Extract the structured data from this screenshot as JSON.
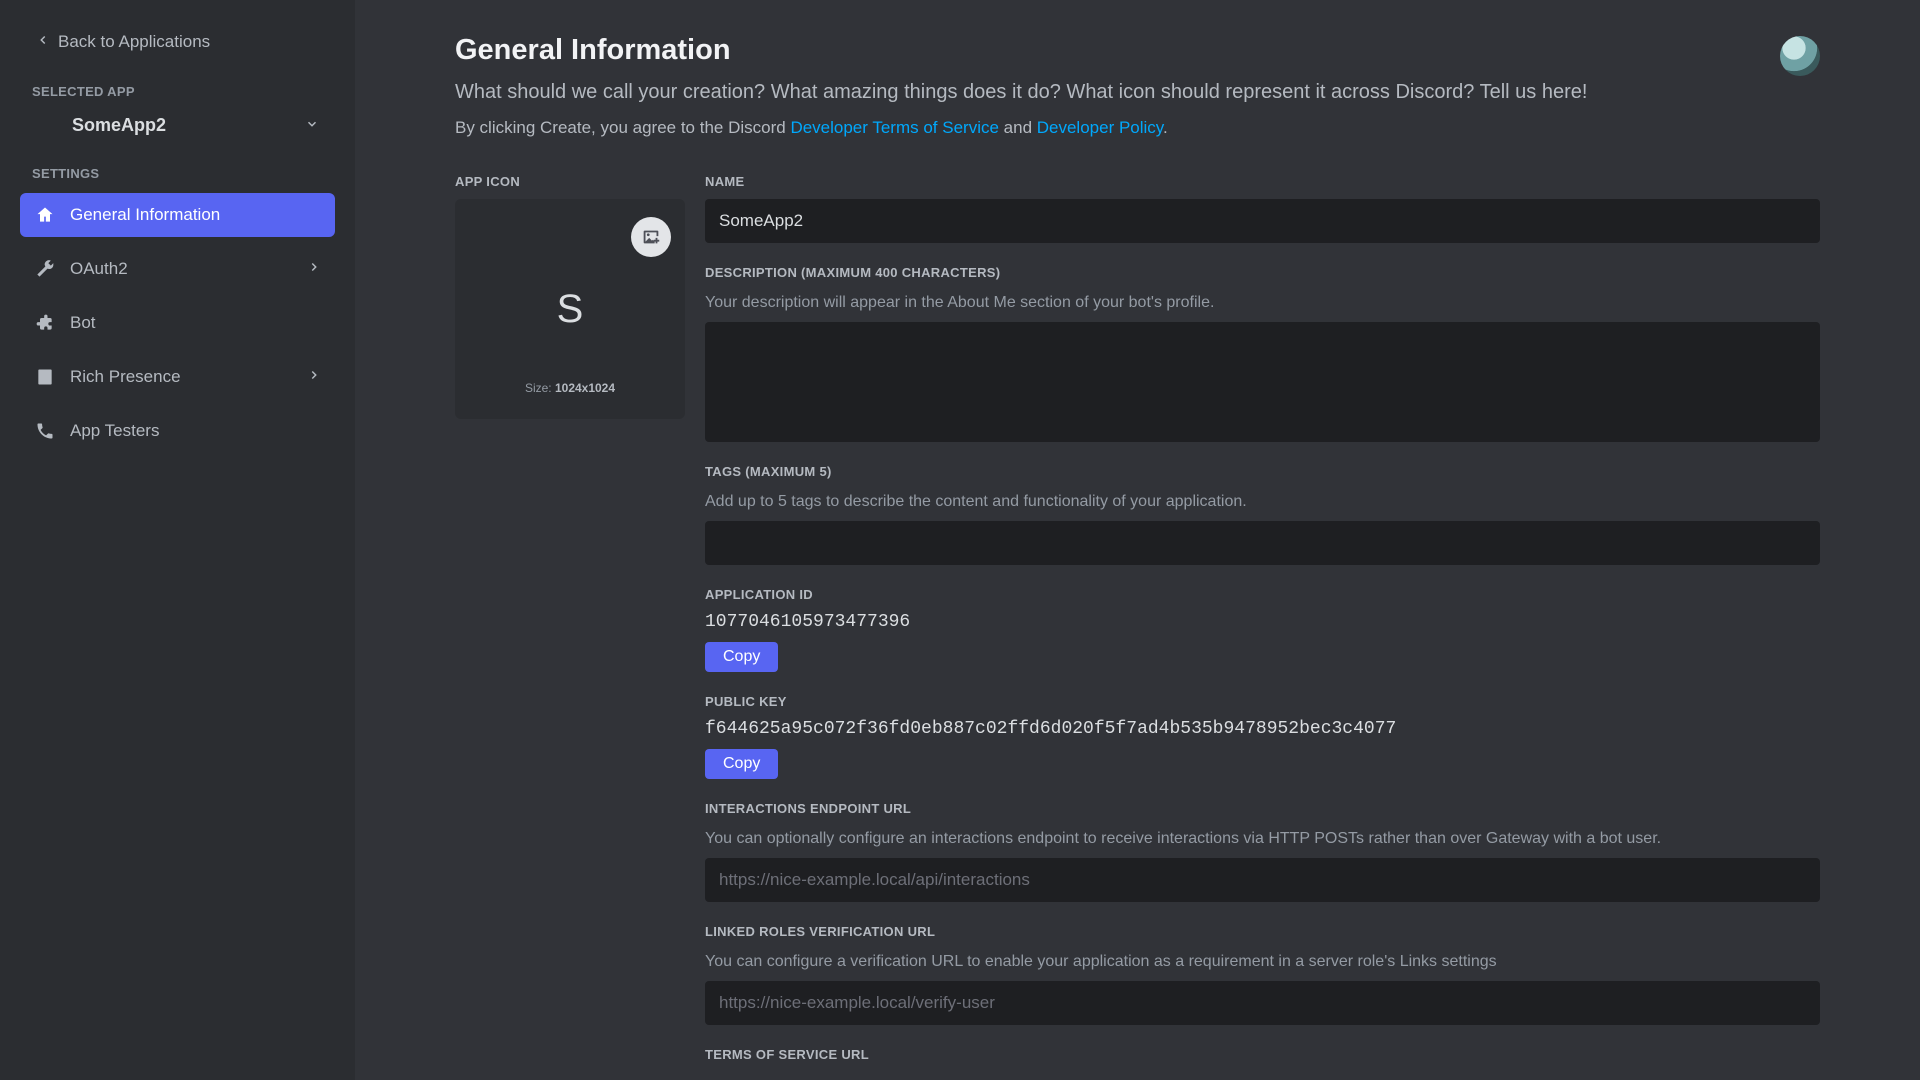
{
  "sidebar": {
    "back_label": "Back to Applications",
    "selected_app_header": "Selected App",
    "selected_app_name": "SomeApp2",
    "settings_header": "Settings",
    "items": [
      {
        "id": "general",
        "label": "General Information",
        "has_chevron": false,
        "active": true
      },
      {
        "id": "oauth2",
        "label": "OAuth2",
        "has_chevron": true,
        "active": false
      },
      {
        "id": "bot",
        "label": "Bot",
        "has_chevron": false,
        "active": false
      },
      {
        "id": "rich",
        "label": "Rich Presence",
        "has_chevron": true,
        "active": false
      },
      {
        "id": "testers",
        "label": "App Testers",
        "has_chevron": false,
        "active": false
      }
    ]
  },
  "header": {
    "title": "General Information",
    "subtitle": "What should we call your creation? What amazing things does it do? What icon should represent it across Discord? Tell us here!",
    "tos_prefix": "By clicking Create, you agree to the Discord ",
    "tos_link1": "Developer Terms of Service",
    "tos_mid": " and ",
    "tos_link2": "Developer Policy",
    "tos_suffix": "."
  },
  "form": {
    "app_icon_label": "App Icon",
    "app_icon_letter": "S",
    "app_icon_size_prefix": "Size:",
    "app_icon_size_value": "1024x1024",
    "name_label": "Name",
    "name_value": "SomeApp2",
    "description_label": "Description (maximum 400 characters)",
    "description_helper": "Your description will appear in the About Me section of your bot's profile.",
    "description_value": "",
    "tags_label": "Tags (maximum 5)",
    "tags_helper": "Add up to 5 tags to describe the content and functionality of your application.",
    "tags_value": "",
    "app_id_label": "Application ID",
    "app_id_value": "1077046105973477396",
    "public_key_label": "Public Key",
    "public_key_value": "f644625a95c072f36fd0eb887c02ffd6d020f5f7ad4b535b9478952bec3c4077",
    "copy_label": "Copy",
    "interactions_label": "Interactions Endpoint URL",
    "interactions_helper": "You can optionally configure an interactions endpoint to receive interactions via HTTP POSTs rather than over Gateway with a bot user.",
    "interactions_placeholder": "https://nice-example.local/api/interactions",
    "linked_roles_label": "Linked Roles Verification URL",
    "linked_roles_helper": "You can configure a verification URL to enable your application as a requirement in a server role's Links settings",
    "linked_roles_placeholder": "https://nice-example.local/verify-user",
    "tos_url_label": "Terms of Service URL"
  }
}
